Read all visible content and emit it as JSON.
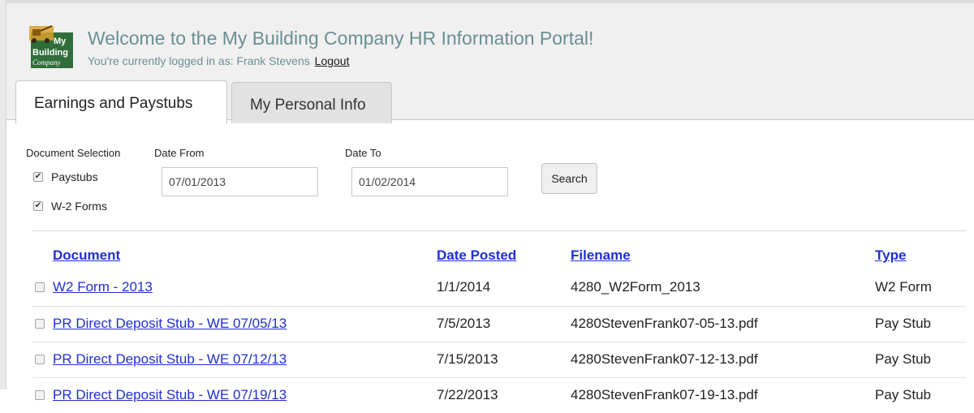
{
  "header": {
    "logo": {
      "lines": [
        "My",
        "Building",
        "Company"
      ],
      "colors": {
        "bg": "#2f6d3a",
        "text": "#ffffff",
        "accent": "#d9a12b"
      }
    },
    "welcome": "Welcome to the My Building Company HR Information Portal!",
    "logged_in_prefix": "You're currently logged in as: Frank Stevens",
    "logout_label": "Logout"
  },
  "tabs": [
    {
      "label": "Earnings and Paystubs",
      "active": true
    },
    {
      "label": "My Personal Info",
      "active": false
    }
  ],
  "filters": {
    "document_selection_label": "Document Selection",
    "options": [
      {
        "label": "Paystubs",
        "checked": true
      },
      {
        "label": "W-2 Forms",
        "checked": true
      }
    ],
    "date_from_label": "Date From",
    "date_from_value": "07/01/2013",
    "date_to_label": "Date To",
    "date_to_value": "01/02/2014",
    "search_label": "Search"
  },
  "table": {
    "columns": [
      "Document",
      "Date Posted",
      "Filename",
      "Type"
    ],
    "rows": [
      {
        "document": "W2 Form - 2013",
        "date_posted": "1/1/2014",
        "filename": "4280_W2Form_2013",
        "type": "W2 Form"
      },
      {
        "document": "PR Direct Deposit Stub - WE 07/05/13",
        "date_posted": "7/5/2013",
        "filename": "4280StevenFrank07-05-13.pdf",
        "type": "Pay Stub"
      },
      {
        "document": "PR Direct Deposit Stub - WE 07/12/13",
        "date_posted": "7/15/2013",
        "filename": "4280StevenFrank07-12-13.pdf",
        "type": "Pay Stub"
      },
      {
        "document": "PR Direct Deposit Stub - WE 07/19/13",
        "date_posted": "7/22/2013",
        "filename": "4280StevenFrank07-19-13.pdf",
        "type": "Pay Stub"
      }
    ]
  },
  "colors": {
    "link": "#1f2fd1",
    "header_text": "#6b8f94",
    "header_bg": "#f0f0f0"
  }
}
